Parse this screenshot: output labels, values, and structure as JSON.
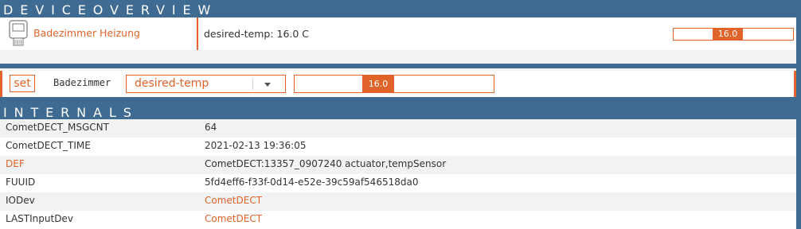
{
  "colors": {
    "accent": "#e0632a",
    "header_bg": "#3f6a92",
    "row_alt": "#f1f2f4"
  },
  "device_overview": {
    "title": "DEVICEOVERVIEW",
    "device_icon": "radiator-thermostat-icon",
    "device_name": "Badezimmer Heizung",
    "state": "desired-temp: 16.0 C",
    "slider_value": "16.0"
  },
  "set_bar": {
    "button_label": "set",
    "device": "Badezimmer",
    "selected_command": "desired-temp",
    "slider_value": "16.0"
  },
  "internals": {
    "title": "INTERNALS",
    "rows": [
      {
        "name": "CometDECT_MSGCNT",
        "value": "64"
      },
      {
        "name": "CometDECT_TIME",
        "value": "2021-02-13 19:36:05"
      },
      {
        "name": "DEF",
        "value": "CometDECT:13357_0907240 actuator,tempSensor"
      },
      {
        "name": "FUUID",
        "value": "5fd4eff6-f33f-0d14-e52e-39c59af546518da0"
      },
      {
        "name": "IODev",
        "value": "CometDECT"
      },
      {
        "name": "LASTInputDev",
        "value": "CometDECT"
      }
    ]
  }
}
